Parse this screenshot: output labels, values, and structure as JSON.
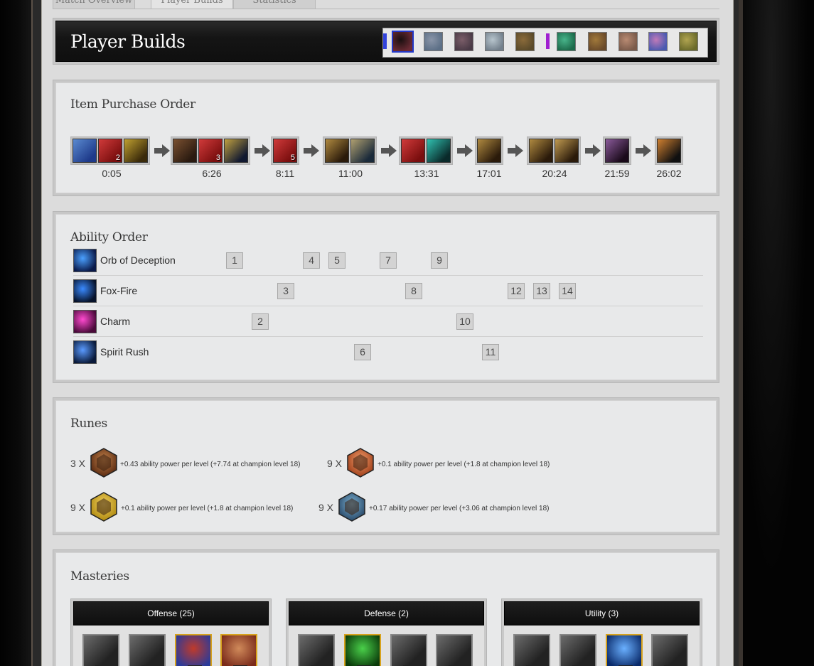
{
  "tabs": [
    {
      "label": "Match Overview",
      "active": false
    },
    {
      "label": "Player Builds",
      "active": true
    },
    {
      "label": "Statistics",
      "active": false
    }
  ],
  "header": {
    "title": "Player Builds"
  },
  "champions": {
    "team_blue_color": "#3344dd",
    "team_purple_color": "#a020d0",
    "blue": [
      {
        "name": "ahri-icon",
        "selected": true,
        "colors": [
          "#6a2a34",
          "#1a1010"
        ]
      },
      {
        "name": "champion-2-icon",
        "colors": [
          "#5c6f86",
          "#8a95a8"
        ]
      },
      {
        "name": "champion-3-icon",
        "colors": [
          "#4a3a46",
          "#7a5d68"
        ]
      },
      {
        "name": "champion-4-icon",
        "colors": [
          "#73808c",
          "#b7c4cc"
        ]
      },
      {
        "name": "champion-5-icon",
        "colors": [
          "#5a4a2a",
          "#8a6a3a"
        ]
      }
    ],
    "purple": [
      {
        "name": "champion-6-icon",
        "colors": [
          "#1c6a4a",
          "#48b48a"
        ]
      },
      {
        "name": "champion-7-icon",
        "colors": [
          "#6a4a2a",
          "#a0783a"
        ]
      },
      {
        "name": "champion-8-icon",
        "colors": [
          "#7a5a4a",
          "#b88a72"
        ]
      },
      {
        "name": "champion-9-icon",
        "colors": [
          "#4a5ab0",
          "#c07ab8"
        ]
      },
      {
        "name": "champion-10-icon",
        "colors": [
          "#6a6a2a",
          "#b0a450"
        ]
      }
    ]
  },
  "items": {
    "title": "Item Purchase Order",
    "groups": [
      {
        "time": "0:05",
        "items": [
          {
            "name": "dorans-ring-icon",
            "count": "",
            "colors": [
              "#1e3a8a",
              "#5a8ad0"
            ]
          },
          {
            "name": "health-potion-icon",
            "count": "2",
            "colors": [
              "#7a0e0e",
              "#d03a3a"
            ]
          },
          {
            "name": "warding-totem-icon",
            "count": "",
            "colors": [
              "#3a2a0a",
              "#c0a030"
            ]
          }
        ]
      },
      {
        "time": "6:26",
        "items": [
          {
            "name": "boots-icon",
            "count": "",
            "colors": [
              "#2a1a10",
              "#7a5030"
            ]
          },
          {
            "name": "health-potion-icon",
            "count": "3",
            "colors": [
              "#7a0e0e",
              "#d03a3a"
            ]
          },
          {
            "name": "chalice-icon",
            "count": "",
            "colors": [
              "#101830",
              "#c0a040"
            ]
          }
        ]
      },
      {
        "time": "8:11",
        "items": [
          {
            "name": "health-potion-icon",
            "count": "5",
            "colors": [
              "#7a0e0e",
              "#d03a3a"
            ]
          }
        ]
      },
      {
        "time": "11:00",
        "items": [
          {
            "name": "tome-icon",
            "count": "",
            "colors": [
              "#2a1a0a",
              "#b08a40"
            ]
          },
          {
            "name": "boots-of-swiftness-icon",
            "count": "",
            "colors": [
              "#1a2a3a",
              "#b0a070"
            ]
          }
        ]
      },
      {
        "time": "13:31",
        "items": [
          {
            "name": "health-potion-icon",
            "count": "",
            "colors": [
              "#7a0e0e",
              "#d03a3a"
            ]
          },
          {
            "name": "wand-icon",
            "count": "",
            "colors": [
              "#0a2a2a",
              "#30c0b0"
            ]
          }
        ]
      },
      {
        "time": "17:01",
        "items": [
          {
            "name": "tome-icon",
            "count": "",
            "colors": [
              "#2a1a0a",
              "#b08a40"
            ]
          }
        ]
      },
      {
        "time": "20:24",
        "items": [
          {
            "name": "tome-icon",
            "count": "",
            "colors": [
              "#2a1a0a",
              "#b08a40"
            ]
          },
          {
            "name": "codex-icon",
            "count": "",
            "colors": [
              "#2a1a0a",
              "#c09a50"
            ]
          }
        ]
      },
      {
        "time": "21:59",
        "items": [
          {
            "name": "void-staff-icon",
            "count": "",
            "colors": [
              "#1a0a1a",
              "#8a5a9a"
            ]
          }
        ]
      },
      {
        "time": "26:02",
        "items": [
          {
            "name": "elixir-icon",
            "count": "",
            "colors": [
              "#101010",
              "#d08030"
            ]
          }
        ]
      }
    ]
  },
  "abilities": {
    "title": "Ability Order",
    "rows": [
      {
        "name": "Orb of Deception",
        "icon": "orb-of-deception-icon",
        "colors": [
          "#0a1a4a",
          "#4aa0ff"
        ],
        "levels": [
          1,
          4,
          5,
          7,
          9
        ]
      },
      {
        "name": "Fox-Fire",
        "icon": "fox-fire-icon",
        "colors": [
          "#06122a",
          "#3a8aff"
        ],
        "levels": [
          3,
          8,
          12,
          13,
          14
        ]
      },
      {
        "name": "Charm",
        "icon": "charm-icon",
        "colors": [
          "#4a0a3a",
          "#ff4ad0"
        ],
        "levels": [
          2,
          10
        ]
      },
      {
        "name": "Spirit Rush",
        "icon": "spirit-rush-icon",
        "colors": [
          "#0a1a3a",
          "#5a9aff"
        ],
        "levels": [
          6,
          11
        ]
      }
    ]
  },
  "runes": {
    "title": "Runes",
    "entries": [
      {
        "count": "3 X",
        "icon": "red-rune-icon",
        "colors": [
          "#5a2a10",
          "#c0804a"
        ],
        "desc": "+0.43 ability power per level (+7.74 at champion level 18)"
      },
      {
        "count": "9 X",
        "icon": "red-rune-icon",
        "colors": [
          "#a0401a",
          "#f09a6a"
        ],
        "desc": "+0.1 ability power per level (+1.8 at champion level 18)"
      },
      {
        "count": "9 X",
        "icon": "yellow-rune-icon",
        "colors": [
          "#b08a10",
          "#f0d060"
        ],
        "desc": "+0.1 ability power per level (+1.8 at champion level 18)"
      },
      {
        "count": "9 X",
        "icon": "blue-rune-icon",
        "colors": [
          "#2a4a6a",
          "#7ab0d0"
        ],
        "desc": "+0.17 ability power per level (+3.06 at champion level 18)"
      }
    ]
  },
  "masteries": {
    "title": "Masteries",
    "trees": [
      {
        "label": "Offense (25)",
        "cells": [
          {
            "name": "mastery-offense-1-icon",
            "gold": false
          },
          {
            "name": "mastery-offense-2-icon",
            "gold": false
          },
          {
            "name": "mastery-offense-3-icon",
            "gold": true,
            "colors": [
              "#2a3a9a",
              "#c03a2a"
            ]
          },
          {
            "name": "mastery-offense-4-icon",
            "gold": true,
            "colors": [
              "#7a2a1a",
              "#d08a5a"
            ]
          }
        ]
      },
      {
        "label": "Defense (2)",
        "cells": [
          {
            "name": "mastery-defense-1-icon",
            "gold": false
          },
          {
            "name": "mastery-defense-2-icon",
            "gold": true,
            "colors": [
              "#0a3a0a",
              "#4ad04a"
            ]
          },
          {
            "name": "mastery-defense-3-icon",
            "gold": false
          },
          {
            "name": "mastery-defense-4-icon",
            "gold": false
          }
        ]
      },
      {
        "label": "Utility (3)",
        "cells": [
          {
            "name": "mastery-utility-1-icon",
            "gold": false
          },
          {
            "name": "mastery-utility-2-icon",
            "gold": false
          },
          {
            "name": "mastery-utility-3-icon",
            "gold": true,
            "colors": [
              "#0a2a6a",
              "#6ab0ff"
            ]
          },
          {
            "name": "mastery-utility-4-icon",
            "gold": false
          }
        ]
      }
    ]
  }
}
